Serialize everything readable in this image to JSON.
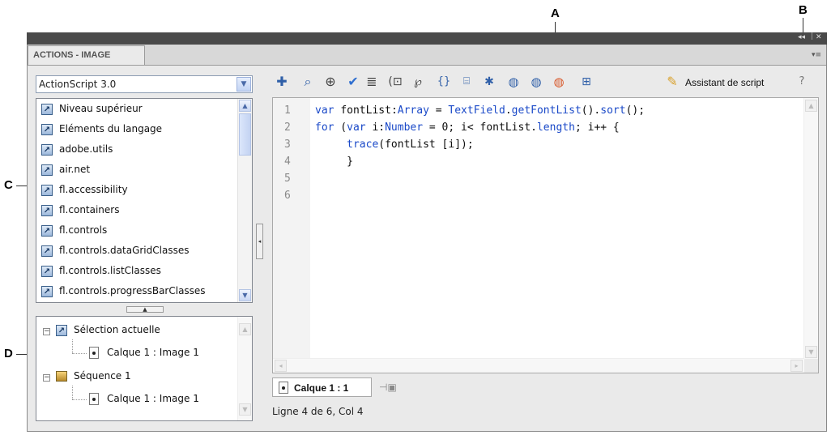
{
  "callouts": {
    "a": "A",
    "b": "B",
    "c": "C",
    "d": "D"
  },
  "panel": {
    "tab_title": "ACTIONS - IMAGE",
    "window_controls": {
      "collapse_glyph": "◂◂",
      "close_glyph": "✕"
    },
    "menu_glyph": "▾≡"
  },
  "language_select": {
    "value": "ActionScript 3.0"
  },
  "toolbox": {
    "items": [
      {
        "label": "Niveau supérieur"
      },
      {
        "label": "Eléments du langage"
      },
      {
        "label": "adobe.utils"
      },
      {
        "label": "air.net"
      },
      {
        "label": "fl.accessibility"
      },
      {
        "label": "fl.containers"
      },
      {
        "label": "fl.controls"
      },
      {
        "label": "fl.controls.dataGridClasses"
      },
      {
        "label": "fl.controls.listClasses"
      },
      {
        "label": "fl.controls.progressBarClasses"
      }
    ]
  },
  "navigator": {
    "current_selection": "Sélection actuelle",
    "current_selection_child": "Calque 1 : Image 1",
    "sequence": "Séquence 1",
    "sequence_child": "Calque 1 : Image 1"
  },
  "toolbar": {
    "icons": [
      "add-statement-icon",
      "find-icon",
      "target-path-icon",
      "check-syntax-icon",
      "auto-format-icon",
      "code-hint-icon",
      "debug-options-icon",
      "collapse-between-braces-icon",
      "collapse-selection-icon",
      "expand-all-icon",
      "apply-block-comment-icon",
      "apply-line-comment-icon",
      "remove-comment-icon",
      "show-hide-toolbox-icon",
      "script-assist-icon",
      "help-icon"
    ],
    "script_assist_label": "Assistant de script"
  },
  "editor": {
    "line_numbers": [
      "1",
      "2",
      "3",
      "4",
      "5",
      "6"
    ],
    "lines": [
      "var fontList:Array = TextField.getFontList().sort();",
      "for (var i:Number = 0; i< fontList.length; i++ {",
      "     trace(fontList [i]);",
      "     }",
      "",
      ""
    ]
  },
  "script_tab": {
    "label": "Calque 1 : 1"
  },
  "status": {
    "text": "Ligne 4 de 6, Col 4"
  }
}
